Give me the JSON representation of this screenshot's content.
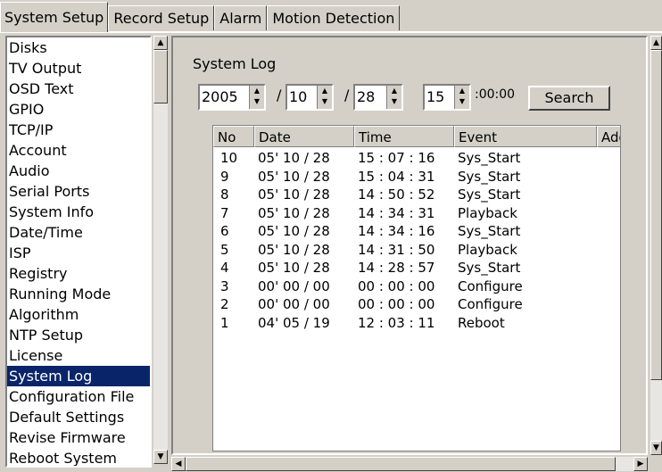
{
  "tabs": [
    "System Setup",
    "Record Setup",
    "Alarm",
    "Motion Detection"
  ],
  "sidebar": {
    "items": [
      "Disks",
      "TV Output",
      "OSD Text",
      "GPIO",
      "TCP/IP",
      "Account",
      "Audio",
      "Serial Ports",
      "System Info",
      "Date/Time",
      "ISP",
      "Registry",
      "Running Mode",
      "Algorithm",
      "NTP Setup",
      "License",
      "System Log",
      "Configuration File",
      "Default Settings",
      "Revise Firmware",
      "Reboot System"
    ],
    "selected": "System Log"
  },
  "panel": {
    "title": "System Log",
    "year": "2005",
    "month": "10",
    "day": "28",
    "hour": "15",
    "sep": "/",
    "time_suffix": ":00:00",
    "search_label": "Search"
  },
  "table": {
    "headers": [
      "No",
      "Date",
      "Time",
      "Event",
      "Add"
    ],
    "rows": [
      [
        "10",
        "05' 10 / 28",
        "15 : 07 : 16",
        "Sys_Start"
      ],
      [
        "9",
        "05' 10 / 28",
        "15 : 04 : 31",
        "Sys_Start"
      ],
      [
        "8",
        "05' 10 / 28",
        "14 : 50 : 52",
        "Sys_Start"
      ],
      [
        "7",
        "05' 10 / 28",
        "14 : 34 : 31",
        "Playback"
      ],
      [
        "6",
        "05' 10 / 28",
        "14 : 34 : 16",
        "Sys_Start"
      ],
      [
        "5",
        "05' 10 / 28",
        "14 : 31 : 50",
        "Playback"
      ],
      [
        "4",
        "05' 10 / 28",
        "14 : 28 : 57",
        "Sys_Start"
      ],
      [
        "3",
        "00' 00 / 00",
        "00 : 00 : 00",
        "Configure"
      ],
      [
        "2",
        "00' 00 / 00",
        "00 : 00 : 00",
        "Configure"
      ],
      [
        "1",
        "04' 05 / 19",
        "12 : 03 : 11",
        "Reboot"
      ]
    ]
  },
  "colors": {
    "selection": "#0a246a",
    "face": "#d4d0c8"
  }
}
